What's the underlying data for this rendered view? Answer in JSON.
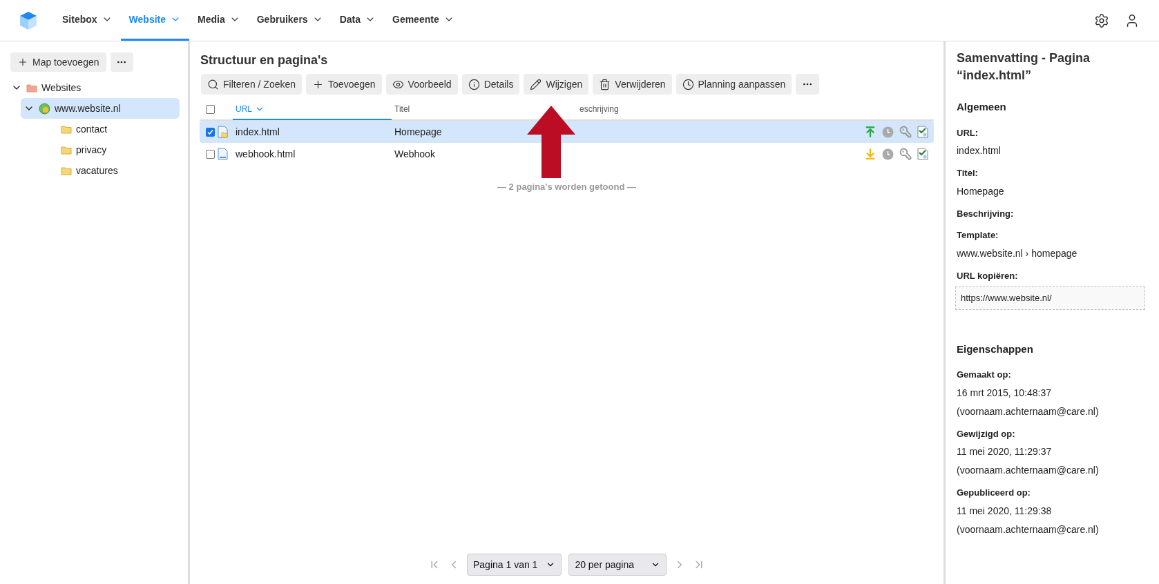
{
  "nav": {
    "items": [
      {
        "label": "Sitebox",
        "selected": false
      },
      {
        "label": "Website",
        "selected": true
      },
      {
        "label": "Media",
        "selected": false
      },
      {
        "label": "Gebruikers",
        "selected": false
      },
      {
        "label": "Data",
        "selected": false
      },
      {
        "label": "Gemeente",
        "selected": false
      }
    ]
  },
  "sidebar": {
    "add_button": "Map toevoegen",
    "tree": [
      {
        "label": "Websites",
        "kind": "root",
        "expanded": true,
        "selected": false,
        "children": [
          {
            "label": "www.website.nl",
            "kind": "site",
            "expanded": true,
            "selected": true,
            "children": [
              {
                "label": "contact",
                "kind": "folder",
                "selected": false
              },
              {
                "label": "privacy",
                "kind": "folder",
                "selected": false
              },
              {
                "label": "vacatures",
                "kind": "folder",
                "selected": false
              }
            ]
          }
        ]
      }
    ]
  },
  "main": {
    "title": "Structuur en pagina's",
    "toolbar": [
      "Filteren / Zoeken",
      "Toevoegen",
      "Voorbeeld",
      "Details",
      "Wijzigen",
      "Verwijderen",
      "Planning aanpassen"
    ],
    "table": {
      "select_all": {
        "checked": false
      },
      "columns": [
        {
          "label": "URL",
          "sorted": true
        },
        {
          "label": "Titel",
          "sorted": false
        },
        {
          "label": "eschrijving",
          "sorted": false
        }
      ],
      "rows": [
        {
          "checked": true,
          "selected": true,
          "kind": "home",
          "url": "index.html",
          "title": "Homepage",
          "published": true
        },
        {
          "checked": false,
          "selected": false,
          "kind": "page",
          "url": "webhook.html",
          "title": "Webhook",
          "published": false
        }
      ],
      "footer": "— 2 pagina's worden getoond —"
    },
    "pagination": {
      "page": "Pagina 1 van 1",
      "per_page": "20 per pagina"
    }
  },
  "summary": {
    "title": "Samenvatting - Pagina “index.html”",
    "sections": [
      {
        "heading": "Algemeen",
        "fields": [
          {
            "kind": "text",
            "label": "URL:",
            "values": [
              "index.html"
            ]
          },
          {
            "kind": "text",
            "label": "Titel:",
            "values": [
              "Homepage"
            ]
          },
          {
            "kind": "text",
            "label": "Beschrijving:"
          },
          {
            "kind": "text",
            "label": "Template:",
            "values": [
              "www.website.nl › homepage"
            ]
          },
          {
            "kind": "copy",
            "label": "URL kopiëren:",
            "values": [
              "https://www.website.nl/"
            ]
          }
        ]
      },
      {
        "heading": "Eigenschappen",
        "fields": [
          {
            "kind": "text",
            "label": "Gemaakt op:",
            "values": [
              "16 mrt 2015, 10:48:37",
              "(voornaam.achternaam@care.nl)"
            ]
          },
          {
            "kind": "text",
            "label": "Gewijzigd op:",
            "values": [
              "11 mei 2020, 11:29:37",
              "(voornaam.achternaam@care.nl)"
            ]
          },
          {
            "kind": "text",
            "label": "Gepubliceerd op:",
            "values": [
              "11 mei 2020, 11:29:38",
              "(voornaam.achternaam@care.nl)"
            ]
          }
        ]
      }
    ]
  }
}
